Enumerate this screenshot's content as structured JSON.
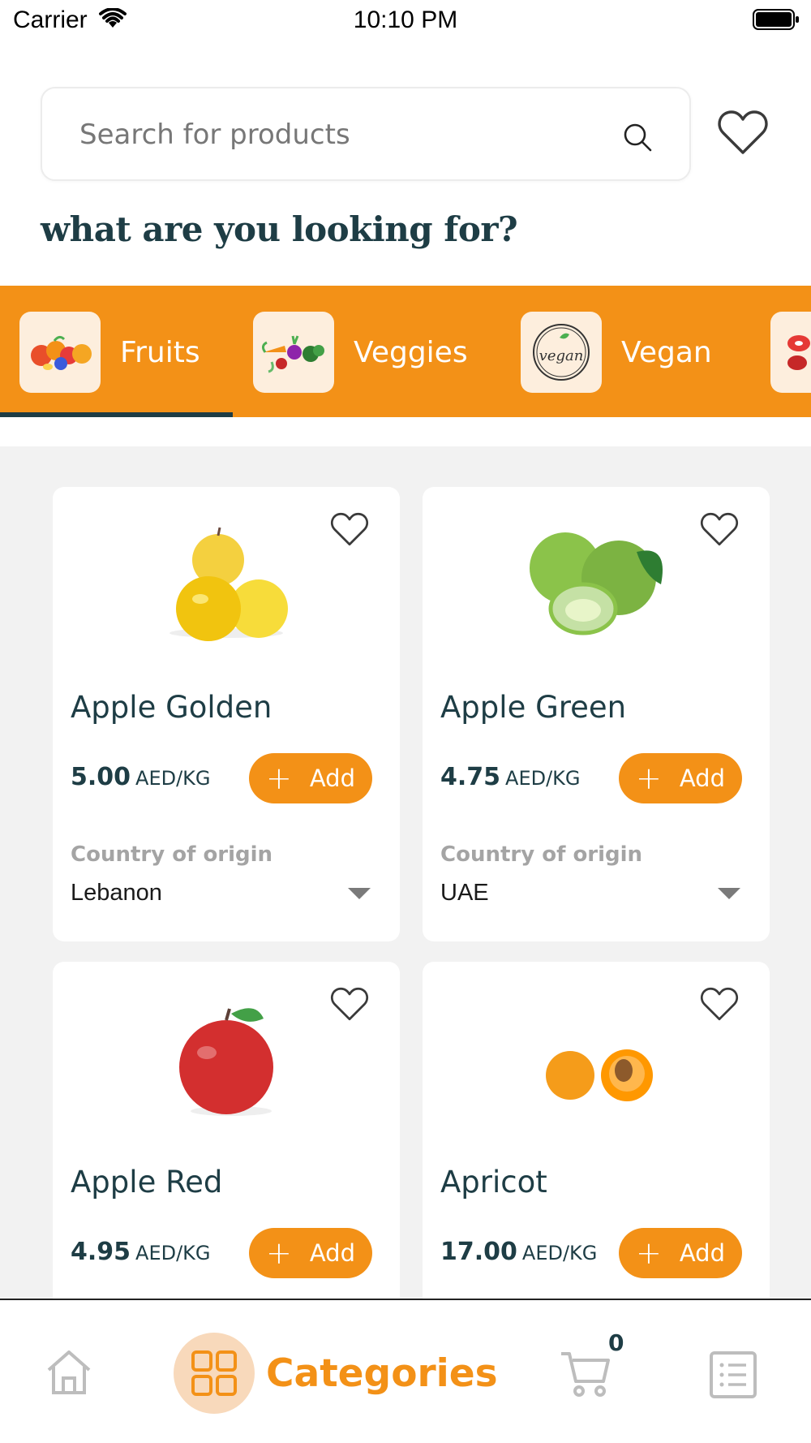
{
  "status_bar": {
    "carrier": "Carrier",
    "time": "10:10 PM"
  },
  "search": {
    "placeholder": "Search for products"
  },
  "heading": "what are you looking for?",
  "categories": [
    {
      "label": "Fruits",
      "icon": "fruits-illustration"
    },
    {
      "label": "Veggies",
      "icon": "veggies-illustration"
    },
    {
      "label": "Vegan",
      "icon": "vegan-badge"
    },
    {
      "label": "",
      "icon": "meat-illustration"
    }
  ],
  "vegan_badge_text": "vegan",
  "selected_category": "Fruits",
  "products": [
    {
      "name": "Apple Golden",
      "price": "5.00",
      "unit": "AED/KG",
      "add_label": "Add",
      "origin_label": "Country of origin",
      "origin": "Lebanon"
    },
    {
      "name": "Apple Green",
      "price": "4.75",
      "unit": "AED/KG",
      "add_label": "Add",
      "origin_label": "Country of origin",
      "origin": "UAE"
    },
    {
      "name": "Apple Red",
      "price": "4.95",
      "unit": "AED/KG",
      "add_label": "Add"
    },
    {
      "name": "Apricot",
      "price": "17.00",
      "unit": "AED/KG",
      "add_label": "Add"
    }
  ],
  "tab_bar": {
    "categories_label": "Categories",
    "cart_count": "0",
    "items": [
      "home-icon",
      "categories-icon",
      "cart-icon",
      "orders-icon"
    ]
  },
  "colors": {
    "accent": "#f39117",
    "primary_text": "#1e3d45",
    "background_grey": "#f2f2f2"
  }
}
